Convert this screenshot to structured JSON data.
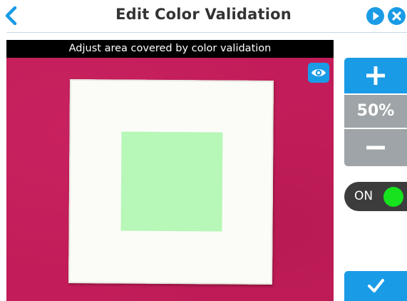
{
  "header": {
    "title": "Edit Color Validation",
    "back_icon": "chevron-left-icon",
    "play_icon": "play-icon",
    "close_icon": "close-icon"
  },
  "camera": {
    "banner_text": "Adjust area covered by color validation",
    "eye_icon": "eye-icon"
  },
  "zoom": {
    "increase_icon": "plus-icon",
    "level": "50%",
    "decrease_icon": "minus-icon"
  },
  "toggle": {
    "label": "ON",
    "state": true
  },
  "confirm": {
    "icon": "checkmark-icon"
  },
  "colors": {
    "accent": "#1a9be6",
    "neutral": "#9ea4a7",
    "toggle_bg": "#3c3c3c",
    "toggle_on": "#16e21e",
    "validation_area": "#b7f7b8",
    "background_surface": "#c21d5a"
  }
}
